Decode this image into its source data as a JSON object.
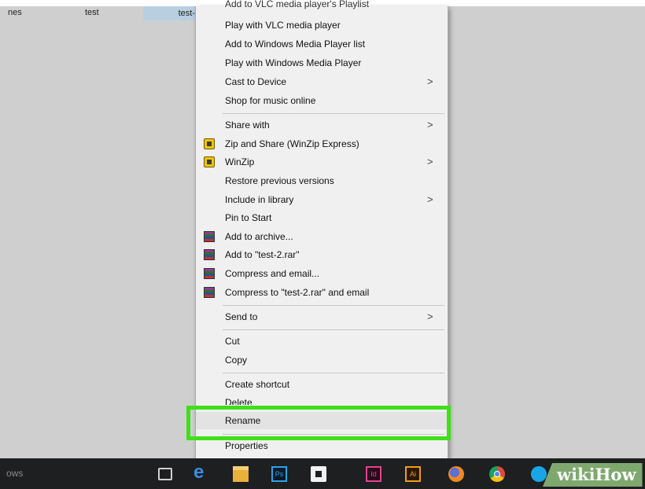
{
  "explorer": {
    "col_name": "nes",
    "col_type": "test",
    "selected_file": "test-"
  },
  "context_menu": {
    "items": [
      {
        "label": "Add to VLC media player's Playlist"
      },
      {
        "label": "Play with VLC media player"
      },
      {
        "label": "Add to Windows Media Player list"
      },
      {
        "label": "Play with Windows Media Player"
      },
      {
        "label": "Cast to Device",
        "submenu": true
      },
      {
        "label": "Shop for music online"
      },
      {
        "label": "Share with",
        "submenu": true
      },
      {
        "label": "Zip and Share (WinZip Express)",
        "icon": "winzip-icon"
      },
      {
        "label": "WinZip",
        "icon": "winzip-icon",
        "submenu": true
      },
      {
        "label": "Restore previous versions"
      },
      {
        "label": "Include in library",
        "submenu": true
      },
      {
        "label": "Pin to Start"
      },
      {
        "label": "Add to archive...",
        "icon": "winrar-icon"
      },
      {
        "label": "Add to \"test-2.rar\"",
        "icon": "winrar-icon"
      },
      {
        "label": "Compress and email...",
        "icon": "winrar-icon"
      },
      {
        "label": "Compress to \"test-2.rar\" and email",
        "icon": "winrar-icon"
      },
      {
        "label": "Send to",
        "submenu": true
      },
      {
        "label": "Cut"
      },
      {
        "label": "Copy"
      },
      {
        "label": "Create shortcut"
      },
      {
        "label": "Delete"
      },
      {
        "label": "Rename",
        "highlighted": true
      },
      {
        "label": "Properties"
      }
    ],
    "submenu_arrow": ">"
  },
  "taskbar": {
    "start_text": "ows",
    "icons": [
      "task-view-icon",
      "edge-icon",
      "file-explorer-icon",
      "photoshop-icon",
      "store-icon",
      "indesign-icon",
      "illustrator-icon",
      "firefox-icon",
      "chrome-icon",
      "skype-icon"
    ],
    "ps_label": "Ps",
    "id_label": "Id",
    "ai_label": "Ai",
    "edge_glyph": "e"
  },
  "watermark": {
    "part1": "wiki",
    "part2": "How"
  },
  "colors": {
    "highlight_border": "#3fe01a",
    "menu_bg": "#f0f0f0",
    "taskbar_bg": "#1d1f21",
    "watermark_bg": "#7fa86e"
  }
}
